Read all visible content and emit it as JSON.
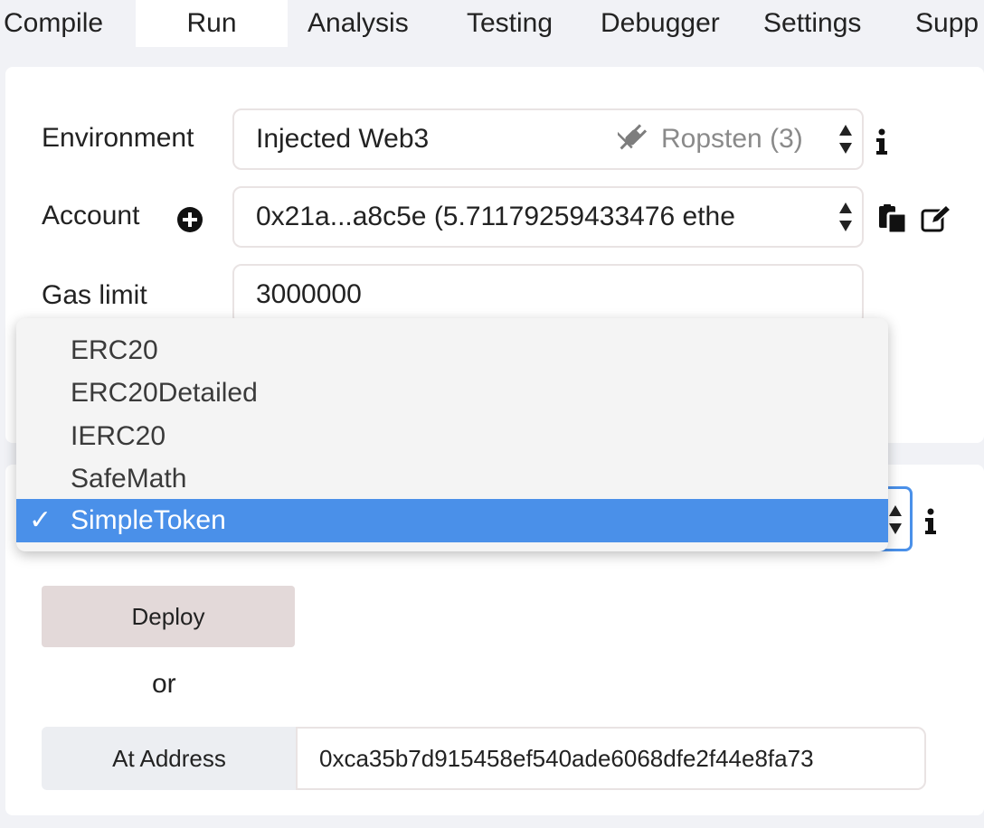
{
  "tabs": [
    {
      "label": "Compile"
    },
    {
      "label": "Run"
    },
    {
      "label": "Analysis"
    },
    {
      "label": "Testing"
    },
    {
      "label": "Debugger"
    },
    {
      "label": "Settings"
    },
    {
      "label": "Supp"
    }
  ],
  "active_tab": "Run",
  "environment": {
    "label": "Environment",
    "value": "Injected Web3",
    "network": "Ropsten (3)"
  },
  "account": {
    "label": "Account",
    "value": "0x21a...a8c5e (5.71179259433476 ethe"
  },
  "gas_limit": {
    "label": "Gas limit",
    "value": "3000000"
  },
  "contract_dropdown": {
    "options": [
      "ERC20",
      "ERC20Detailed",
      "IERC20",
      "SafeMath",
      "SimpleToken"
    ],
    "selected": "SimpleToken",
    "check_glyph": "✓"
  },
  "deploy": {
    "button_label": "Deploy",
    "or_text": "or",
    "at_address_label": "At Address",
    "address_value": "0xca35b7d915458ef540ade6068dfe2f44e8fa73"
  },
  "icons": [
    "info-icon",
    "add-account-icon",
    "plug-icon",
    "copy-icon",
    "edit-icon",
    "select-arrows-icon",
    "check-icon"
  ],
  "colors": {
    "selection": "#4a90e9",
    "deploy_button": "#e3d9d9",
    "background": "#f1f2f6"
  }
}
